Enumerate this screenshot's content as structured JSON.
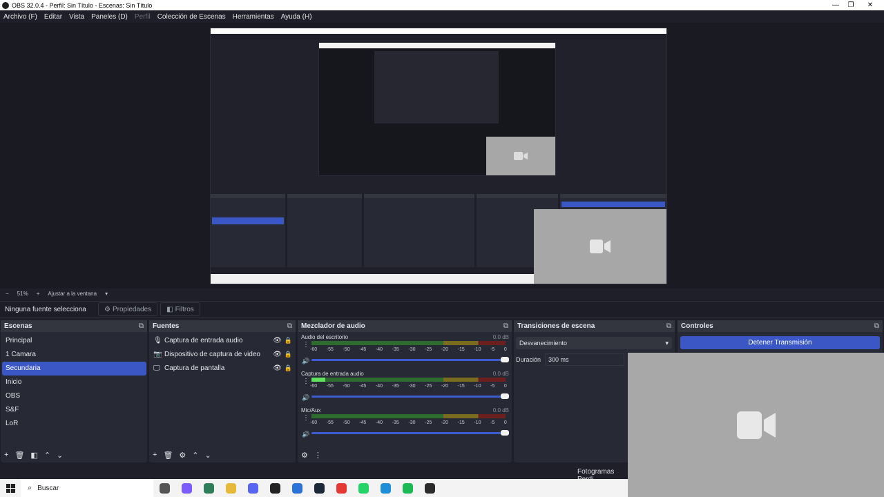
{
  "window": {
    "title": "OBS 32.0.4 - Perfil: Sin Título - Escenas: Sin Título",
    "minimize": "—",
    "maximize": "❐",
    "close": "✕"
  },
  "menu": {
    "items": [
      "Archivo (F)",
      "Editar",
      "Vista",
      "Paneles (D)",
      "Perfil",
      "Colección de Escenas",
      "Herramientas",
      "Ayuda (H)"
    ]
  },
  "zoom": {
    "minus": "−",
    "value": "51%",
    "plus": "+",
    "fit": "Ajustar a la ventana",
    "dropdown": "▾"
  },
  "source_bar": {
    "no_source": "Ninguna fuente selecciona",
    "properties": "Propiedades",
    "filters": "Filtros"
  },
  "scenes": {
    "title": "Escenas",
    "items": [
      "Principal",
      "1 Camara",
      "Secundaria",
      "Inicio",
      "OBS",
      "S&F",
      "LoR"
    ],
    "selected_index": 2
  },
  "sources": {
    "title": "Fuentes",
    "items": [
      {
        "label": "Captura de entrada audio",
        "icon": "microphone-icon"
      },
      {
        "label": "Dispositivo de captura de video",
        "icon": "camera-icon"
      },
      {
        "label": "Captura de pantalla",
        "icon": "monitor-icon"
      }
    ]
  },
  "mixer": {
    "title": "Mezclador de audio",
    "scale": [
      "-60",
      "-55",
      "-50",
      "-45",
      "-40",
      "-35",
      "-30",
      "-25",
      "-20",
      "-15",
      "-10",
      "-5",
      "0"
    ],
    "channels": [
      {
        "name": "Audio del escritorio",
        "db": "0.0 dB",
        "level": 0.0,
        "volume": 1.0
      },
      {
        "name": "Captura de entrada audio",
        "db": "0.0 dB",
        "level": 0.07,
        "volume": 1.0
      },
      {
        "name": "Mic/Aux",
        "db": "0.0 dB",
        "level": 0.0,
        "volume": 1.0
      }
    ]
  },
  "transitions": {
    "title": "Transiciones de escena",
    "selected": "Desvanecimiento",
    "duration_label": "Duración",
    "duration_value": "300 ms"
  },
  "controls": {
    "title": "Controles",
    "stop_stream": "Detener Transmisión"
  },
  "status": {
    "frames": "Fotogramas Perdi"
  },
  "taskbar": {
    "search": "Buscar",
    "apps": [
      {
        "name": "task-view-icon",
        "color": "#555555"
      },
      {
        "name": "copilot-icon",
        "color": "#7c5cff"
      },
      {
        "name": "calculator-icon",
        "color": "#2f7d5a"
      },
      {
        "name": "explorer-icon",
        "color": "#e7b93b"
      },
      {
        "name": "discord-icon",
        "color": "#5865f2"
      },
      {
        "name": "epic-games-icon",
        "color": "#222222"
      },
      {
        "name": "app-blue-icon",
        "color": "#2b73d8"
      },
      {
        "name": "steam-icon",
        "color": "#1b2838"
      },
      {
        "name": "youtube-icon",
        "color": "#e53935"
      },
      {
        "name": "whatsapp-icon",
        "color": "#25d366"
      },
      {
        "name": "edge-icon",
        "color": "#1f8ed6"
      },
      {
        "name": "spotify-icon",
        "color": "#1db954"
      },
      {
        "name": "obs-icon",
        "color": "#2b2b2b"
      }
    ]
  },
  "colors": {
    "accent": "#3b57c5",
    "panel": "#272934",
    "background": "#1e1f29"
  }
}
